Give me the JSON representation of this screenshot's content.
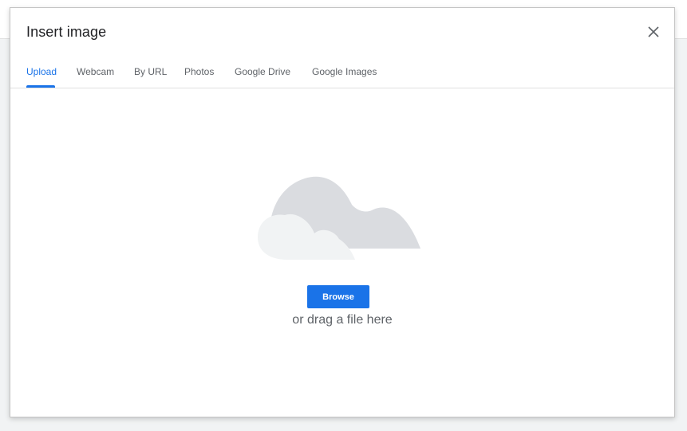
{
  "dialog": {
    "title": "Insert image",
    "close_icon": "close-icon"
  },
  "tabs": [
    {
      "label": "Upload",
      "active": true
    },
    {
      "label": "Webcam",
      "active": false
    },
    {
      "label": "By URL",
      "active": false
    },
    {
      "label": "Photos",
      "active": false
    },
    {
      "label": "Google Drive",
      "active": false
    },
    {
      "label": "Google Images",
      "active": false
    }
  ],
  "upload": {
    "illustration_icon": "cloud-icon",
    "browse_label": "Browse",
    "drag_text": "or drag a file here"
  },
  "colors": {
    "accent": "#1a73e8",
    "title_text": "#202124",
    "secondary_text": "#5f6368",
    "cloud_back": "#dadce0",
    "cloud_front": "#f1f3f4"
  }
}
